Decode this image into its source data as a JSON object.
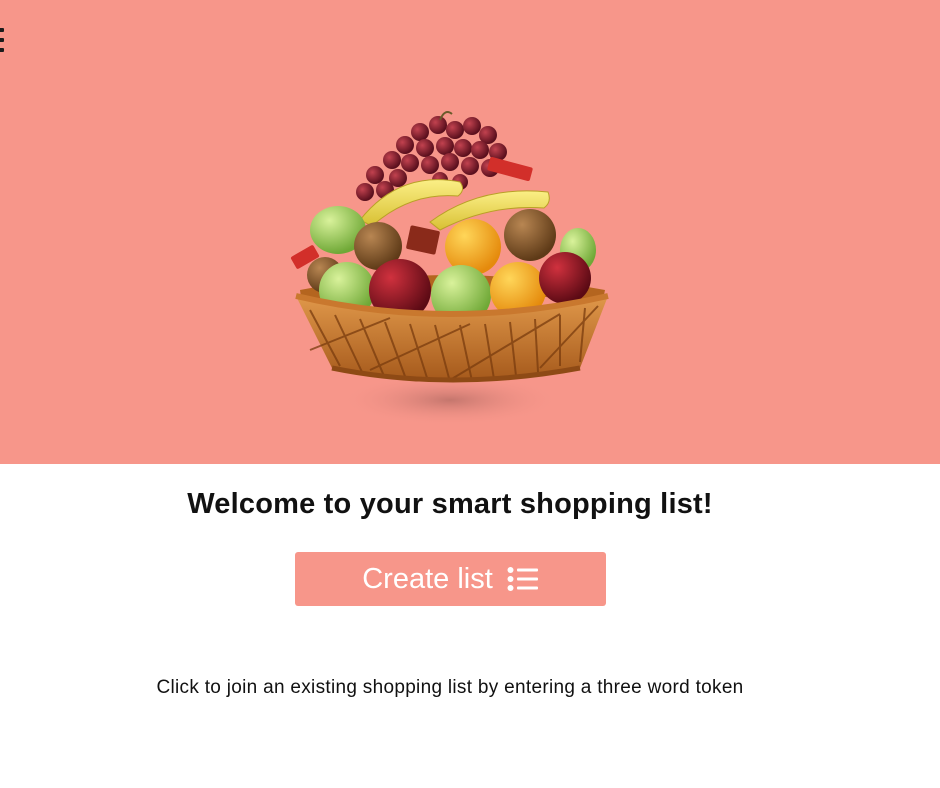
{
  "header": {
    "menu_icon": "hamburger-menu-icon"
  },
  "hero": {
    "background_color": "#f7968a",
    "image": "fruit-basket-icon"
  },
  "main": {
    "title": "Welcome to your smart shopping list!",
    "create_button": {
      "label": "Create list",
      "icon": "list-icon",
      "color": "#f7968a"
    },
    "join_link_text": "Click to join an existing shopping list by entering a three word token"
  }
}
